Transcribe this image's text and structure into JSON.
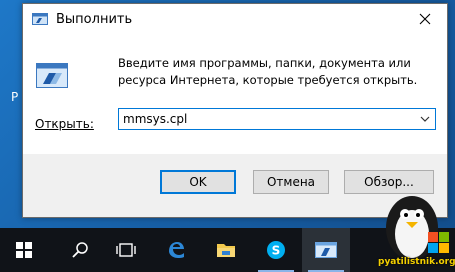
{
  "dialog": {
    "title": "Выполнить",
    "description": "Введите имя программы, папки, документа или ресурса Интернета, которые требуется открыть.",
    "open_label": "Открыть:",
    "open_value": "mmsys.cpl",
    "buttons": {
      "ok": "OK",
      "cancel": "Отмена",
      "browse": "Обзор..."
    }
  },
  "desktop": {
    "partial_letter": "P"
  },
  "taskbar": {
    "items": [
      "start-icon",
      "search-icon",
      "task-view-icon",
      "edge-icon",
      "file-explorer-icon",
      "skype-icon",
      "run-icon"
    ]
  },
  "watermark": {
    "text": "pyatilistnik.org"
  },
  "colors": {
    "accent": "#0078d7",
    "desktop": "#1d6fb8",
    "taskbar": "#101318"
  }
}
